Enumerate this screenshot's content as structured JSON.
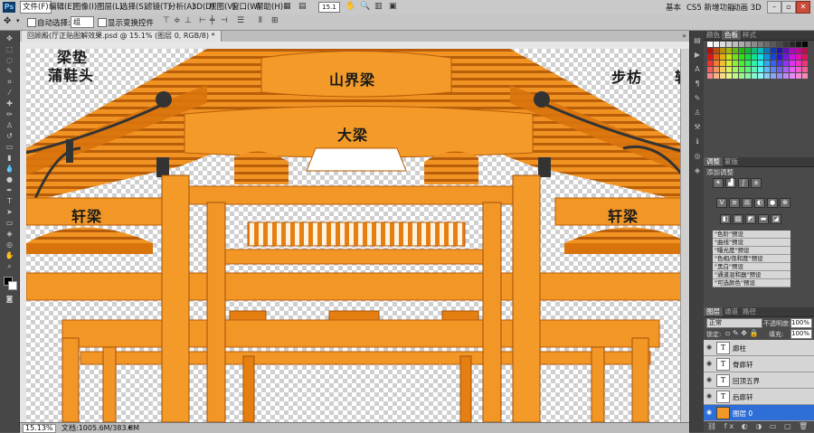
{
  "menubar": {
    "items": [
      "文件(F)",
      "编辑(E)",
      "图像(I)",
      "图层(L)",
      "选择(S)",
      "滤镜(T)",
      "分析(A)",
      "3D(D)",
      "视图(V)",
      "窗口(W)",
      "帮助(H)"
    ],
    "zoom_field": "15.1",
    "workspaces": [
      "基本",
      "CS5 新增功能",
      "动画 3D"
    ]
  },
  "options": {
    "auto_select_label": "自动选择:",
    "auto_select_value": "组",
    "show_transform_label": "显示变换控件"
  },
  "document": {
    "tab_title": "回顾殿(厅正贴图解效果.psd @ 15.1% (图层 0, RGB/8) *",
    "labels": {
      "liangdian": "梁垫",
      "puxietou": "蒲鞋头",
      "shanjieliang": "山界梁",
      "bufang": "步枋",
      "dali": "大梁",
      "xuanliang_left": "轩梁",
      "xuanliang_right": "轩梁",
      "edge": "轩"
    }
  },
  "status": {
    "zoom": "15.13%",
    "doc_info": "文档:1005.6M/383.8M"
  },
  "panels": {
    "top_tabs": [
      "颜色",
      "色板",
      "样式"
    ],
    "adjust_tabs": [
      "调整",
      "蒙版"
    ],
    "adjust_title": "添加调整",
    "presets": [
      "\"色阶\"预设",
      "\"曲线\"预设",
      "\"曝光度\"预设",
      "\"色相/饱和度\"预设",
      "\"黑白\"预设",
      "\"通道混和器\"预设",
      "\"可选颜色\"预设"
    ],
    "layer_tabs": [
      "图层",
      "通道",
      "路径"
    ],
    "blend_mode": "正常",
    "opacity_label": "不透明度:",
    "opacity_value": "100%",
    "lock_label": "锁定:",
    "fill_label": "填充:",
    "fill_value": "100%",
    "layers": [
      {
        "name": "廊柱",
        "type": "text",
        "selected": false
      },
      {
        "name": "脊廊轩",
        "type": "text",
        "selected": false
      },
      {
        "name": "回顶五界",
        "type": "text",
        "selected": false
      },
      {
        "name": "后廊轩",
        "type": "text",
        "selected": false
      },
      {
        "name": "图层 0",
        "type": "image",
        "selected": true
      }
    ]
  },
  "colors": {
    "accent_orange": "#ef8a17",
    "wood_dark": "#c86a0c",
    "selected_layer": "#2d6fd6"
  }
}
